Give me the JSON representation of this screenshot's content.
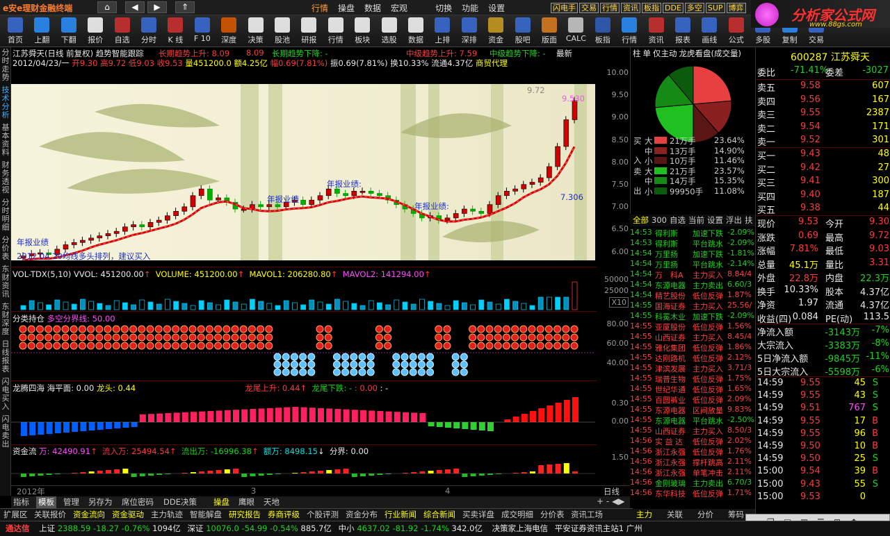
{
  "app": {
    "logo": "e安e理财金融终端",
    "nav": [
      "行情",
      "操盘",
      "数据",
      "宏观",
      "切换",
      "功能",
      "设置"
    ],
    "badges": [
      "闪电手",
      "交易",
      "行情",
      "资讯",
      "板指",
      "DDE",
      "多空",
      "SUP",
      "博弈"
    ],
    "brand": "分析家公式网",
    "brand_url": "www.88gs.com"
  },
  "toolbar": [
    "首页",
    "上翻",
    "下翻",
    "报价",
    "自选",
    "分时",
    "K 线",
    "F 10",
    "深度",
    "决策",
    "股池",
    "研报",
    "行情",
    "板块",
    "选股",
    "数据",
    "上排",
    "深排",
    "资金",
    "股吧",
    "版面",
    "CALC",
    "板指",
    "行情",
    "资讯",
    "报表",
    "画线",
    "公式",
    "多股",
    "复制",
    "交易"
  ],
  "left_tabs": [
    "分时走势",
    "技术分析",
    "基本资料",
    "财务透视",
    "分时明细",
    "分价表",
    "东财资讯",
    "东财深度",
    "日线报表",
    "闪电买入",
    "闪电卖出"
  ],
  "chart_header": {
    "title": "江苏舜天(日线 前复权) 趋势智能跟踪",
    "long_up": "长期趋势上升: 8.09",
    "v2": "8.09",
    "long_down": "长期趋势下降: -",
    "mid_up": "中级趋势上升: 7.59",
    "mid_down": "中级趋势下降: -",
    "latest": "最新"
  },
  "quote_line": {
    "date": "2012/04/23/一",
    "open": "开9.30",
    "high": "高9.72",
    "low": "低9.03",
    "close": "收9.53",
    "vol": "量451200.0",
    "amt": "额4.25亿",
    "amp": "幅0.69(7.81%)",
    "swing": "振0.69(7.81%)",
    "turn": "换10.33%",
    "float": "流通4.37亿",
    "industry": "商贸代理"
  },
  "price_chart": {
    "labels": {
      "hi": "9.72",
      "last": "9.530",
      "low": "7.306",
      "annual": "年报业绩:",
      "annual2": "年报业绩",
      "annual3": "年报业绩:",
      "annual4": "年报业绩",
      "note": "2012.04.20均线多头排列，建议买入"
    },
    "yaxis": [
      "10.00",
      "9.50",
      "9.00",
      "8.50",
      "8.00",
      "7.50",
      "7.00",
      "6.50",
      "6.00"
    ]
  },
  "vol_panel": {
    "header": "VOL-TDX(5,10)",
    "vvol": "VVOL: 451200.00",
    "volume": "VOLUME: 451200.00",
    "mavol1": "MAVOL1: 206280.80",
    "mavol2": "MAVOL2: 141294.00",
    "yaxis": [
      "50000",
      "25000",
      "X10"
    ]
  },
  "pos_panel": {
    "header": "分类持仓",
    "line": "多空分界线: 50.00",
    "yaxis": [
      "80.00",
      "60.00",
      "40.00"
    ]
  },
  "dragon_panel": {
    "header": "龙腾四海",
    "sea": "海平面: 0.00",
    "head": "龙头: 0.44",
    "up": "龙尾上升: 0.44",
    "down": "龙尾下跌: -",
    "val": ": 0.00",
    "sep": ": -",
    "yaxis": [
      "0.30",
      "0.00"
    ]
  },
  "fund_panel": {
    "header": "资金流",
    "wan": "万: 42490.91",
    "in": "流入万: 25494.54",
    "out": "流出万: -16996.38",
    "amt": "额万: 8498.15",
    "div": "分界: 0.00",
    "yaxis": [
      "1.50"
    ]
  },
  "xaxis": {
    "y2012": "2012年",
    "m3": "3",
    "m4": "4",
    "period": "日线"
  },
  "bottom_tabs1": [
    "指标",
    "模板",
    "管理",
    "另存为",
    "席位密码",
    "DDE决策",
    "操盘",
    "鹰眼",
    "天地"
  ],
  "bottom_tabs2": [
    "扩展区",
    "关联报价",
    "资金流向",
    "资金驱动",
    "主力轨迹",
    "智能解盘",
    "研究报告",
    "券商评级",
    "个股评测",
    "资金分布",
    "行业新闻",
    "综合新闻",
    "买卖详盘",
    "成交明细",
    "分价表",
    "资讯工场"
  ],
  "right_bottom_tabs": [
    "主力",
    "关联",
    "分价",
    "筹码"
  ],
  "statusbar": {
    "logo": "通达信",
    "sh": "上证",
    "sh_v": "2388.59",
    "sh_c": "-18.27",
    "sh_p": "-0.76%",
    "sh_a": "1094亿",
    "sz": "深证",
    "sz_v": "10076.0",
    "sz_c": "-54.99",
    "sz_p": "-0.54%",
    "sz_a": "885.7亿",
    "zx": "中小",
    "zx_v": "4637.02",
    "zx_c": "-81.92",
    "zx_p": "-1.74%",
    "zx_a": "342.0亿",
    "ticker": "决策家上海电信",
    "site": "平安证券资讯主站1",
    "city": "广州"
  },
  "pie_panel": {
    "tabs": [
      "柱",
      "单",
      "仅主动",
      "龙虎看盘(成交量)"
    ],
    "side_buy": "买",
    "side_in": "入",
    "side_sell": "卖",
    "side_out": "出",
    "rows": [
      [
        "大",
        "21万手",
        "23.64%",
        "#e84040"
      ],
      [
        "中",
        "13万手",
        "14.90%",
        "#8a2020"
      ],
      [
        "小",
        "10万手",
        "11.46%",
        "#5a1515"
      ],
      [
        "大",
        "21万手",
        "23.57%",
        "#1fc01f"
      ],
      [
        "中",
        "14万手",
        "15.35%",
        "#158a15"
      ],
      [
        "小",
        "99950手",
        "11.08%",
        "#0c5a0c"
      ]
    ],
    "pie": [
      23.64,
      14.9,
      11.46,
      23.57,
      15.35,
      11.08
    ],
    "filter": [
      "全部",
      "300",
      "自选",
      "当前",
      "设置",
      "浮出",
      "扶"
    ]
  },
  "news": [
    [
      "14:53",
      "得利斯",
      "加速下跌",
      "-2.09%"
    ],
    [
      "14:53",
      "得利斯",
      "平台跳水",
      "-2.09%"
    ],
    [
      "14:54",
      "万里扬",
      "加速下跌",
      "-1.81%"
    ],
    [
      "14:54",
      "万里扬",
      "平台跳水",
      "-2.14%"
    ],
    [
      "14:54",
      "万　科A",
      "主力买入",
      "8.84/4"
    ],
    [
      "14:54",
      "东源电器",
      "主力卖出",
      "6.60/3"
    ],
    [
      "14:54",
      "精艺股份",
      "低位反弹",
      "1.87%"
    ],
    [
      "14:55",
      "国海证券",
      "主力买入",
      "25.56/"
    ],
    [
      "14:55",
      "科冕木业",
      "加速下跌",
      "-2.09%"
    ],
    [
      "14:55",
      "亚厦股份",
      "低位反弹",
      "1.56%"
    ],
    [
      "14:55",
      "山西证券",
      "主力买入",
      "8.45/4"
    ],
    [
      "14:55",
      "雅化集团",
      "低位反弹",
      "1.86%"
    ],
    [
      "14:55",
      "达刚路机",
      "低位反弹",
      "2.12%"
    ],
    [
      "14:55",
      "津滨发展",
      "主力买入",
      "3.71/3"
    ],
    [
      "14:55",
      "瑞普生物",
      "低位反弹",
      "1.75%"
    ],
    [
      "14:55",
      "世纪华通",
      "低位反弹",
      "1.65%"
    ],
    [
      "14:55",
      "百圆裤业",
      "低位反弹",
      "2.09%"
    ],
    [
      "14:55",
      "东源电器",
      "区间放量",
      "9.83%"
    ],
    [
      "14:55",
      "东源电器",
      "平台跳水",
      "-2.50%"
    ],
    [
      "14:55",
      "山西证券",
      "主力买入",
      "8.50/3"
    ],
    [
      "14:56",
      "实 益 达",
      "低位反弹",
      "2.02%"
    ],
    [
      "14:56",
      "浙江永强",
      "低位反弹",
      "1.76%"
    ],
    [
      "14:56",
      "浙江永强",
      "撑杆跳高",
      "2.11%"
    ],
    [
      "14:56",
      "浙江永强",
      "单笔冲击",
      "2.11%"
    ],
    [
      "14:56",
      "金刚玻璃",
      "主力卖出",
      "6.70/3"
    ],
    [
      "14:56",
      "东华科技",
      "低位反弹",
      "1.71%"
    ]
  ],
  "quote": {
    "code": "600287",
    "name": "江苏舜天",
    "weibi_l": "委比",
    "weibi": "-71.41%",
    "weicha_l": "委差",
    "weicha": "-3027",
    "asks": [
      [
        "卖五",
        "9.58",
        "607"
      ],
      [
        "卖四",
        "9.56",
        "167"
      ],
      [
        "卖三",
        "9.55",
        "2387"
      ],
      [
        "卖二",
        "9.54",
        "171"
      ],
      [
        "卖一",
        "9.52",
        "301"
      ]
    ],
    "bids": [
      [
        "买一",
        "9.43",
        "48"
      ],
      [
        "买二",
        "9.42",
        "27"
      ],
      [
        "买三",
        "9.41",
        "300"
      ],
      [
        "买四",
        "9.40",
        "187"
      ],
      [
        "买五",
        "9.38",
        "44"
      ]
    ],
    "stats": [
      [
        "现价",
        "9.53",
        "今开",
        "9.30"
      ],
      [
        "涨跌",
        "0.69",
        "最高",
        "9.72"
      ],
      [
        "涨幅",
        "7.81%",
        "最低",
        "9.03"
      ],
      [
        "总量",
        "45.1万",
        "量比",
        "3.31"
      ],
      [
        "外盘",
        "22.8万",
        "内盘",
        "22.3万"
      ],
      [
        "换手",
        "10.33%",
        "股本",
        "4.37亿"
      ],
      [
        "净资",
        "1.97",
        "流通",
        "4.37亿"
      ],
      [
        "收益(四)",
        "0.084",
        "PE(动)",
        "113.5"
      ]
    ],
    "flows": [
      [
        "净流入额",
        "-3143万",
        "-7%"
      ],
      [
        "大宗流入",
        "-3383万",
        "-8%"
      ],
      [
        "5日净流入额",
        "-9845万",
        "-11%"
      ],
      [
        "5日大宗流入",
        "-5598万",
        "-6%"
      ]
    ],
    "ticks": [
      [
        "14:59",
        "9.55",
        "45",
        "S"
      ],
      [
        "14:59",
        "9.55",
        "43",
        "S"
      ],
      [
        "14:59",
        "9.51",
        "767",
        "S"
      ],
      [
        "14:59",
        "9.55",
        "17",
        "B"
      ],
      [
        "14:59",
        "9.55",
        "96",
        "B"
      ],
      [
        "14:59",
        "9.50",
        "10",
        "B"
      ],
      [
        "14:59",
        "9.50",
        "25",
        "S"
      ],
      [
        "15:00",
        "9.54",
        "39",
        "B"
      ],
      [
        "15:00",
        "9.43",
        "55",
        "S"
      ],
      [
        "15:00",
        "9.53",
        "0",
        ""
      ]
    ]
  }
}
